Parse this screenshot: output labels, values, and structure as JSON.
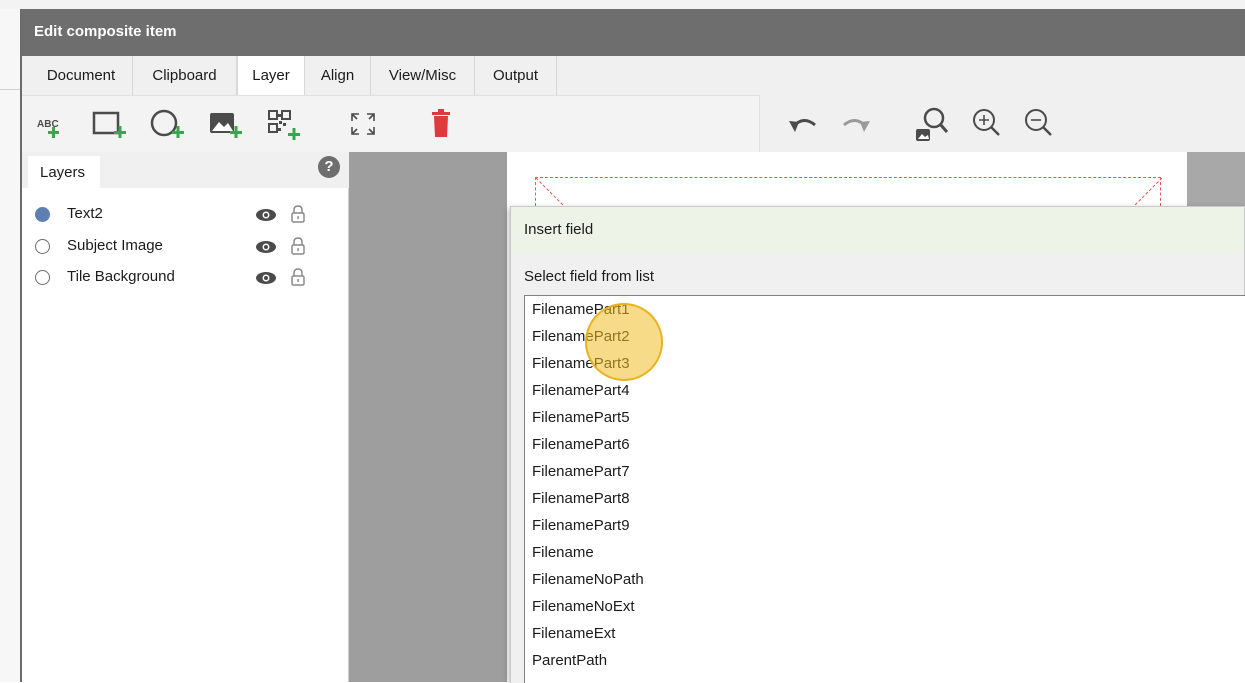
{
  "window": {
    "title": "Edit composite item"
  },
  "tabs": [
    "Document",
    "Clipboard",
    "Layer",
    "Align",
    "View/Misc",
    "Output"
  ],
  "active_tab": "Layer",
  "toolbar": {
    "icons": [
      "add-text-icon",
      "add-rectangle-icon",
      "add-ellipse-icon",
      "add-image-icon",
      "add-qrcode-icon",
      "fit-expand-icon",
      "delete-icon",
      "undo-icon",
      "redo-icon",
      "zoom-fit-image-icon",
      "zoom-in-icon",
      "zoom-out-icon"
    ],
    "add_text_glyph": "ABC"
  },
  "layers": {
    "tab_label": "Layers",
    "help_glyph": "?",
    "items": [
      {
        "label": "Text2",
        "selected": true
      },
      {
        "label": "Subject Image",
        "selected": false
      },
      {
        "label": "Tile Background",
        "selected": false
      }
    ]
  },
  "dialog": {
    "title": "Insert field",
    "prompt": "Select field from list",
    "fields": [
      "FilenamePart1",
      "FilenamePart2",
      "FilenamePart3",
      "FilenamePart4",
      "FilenamePart5",
      "FilenamePart6",
      "FilenamePart7",
      "FilenamePart8",
      "FilenamePart9",
      "Filename",
      "FilenameNoPath",
      "FilenameNoExt",
      "FilenameExt",
      "ParentPath"
    ]
  },
  "colors": {
    "titlebar": "#6e6e6e",
    "selected_radio": "#5f7fb3",
    "delete_icon": "#e0393e",
    "add_plus": "#3aa64a",
    "dialog_title_bg": "#eef3e8",
    "dashed_frame": "#e05a5a",
    "cursor_highlight": "#f0be28"
  }
}
